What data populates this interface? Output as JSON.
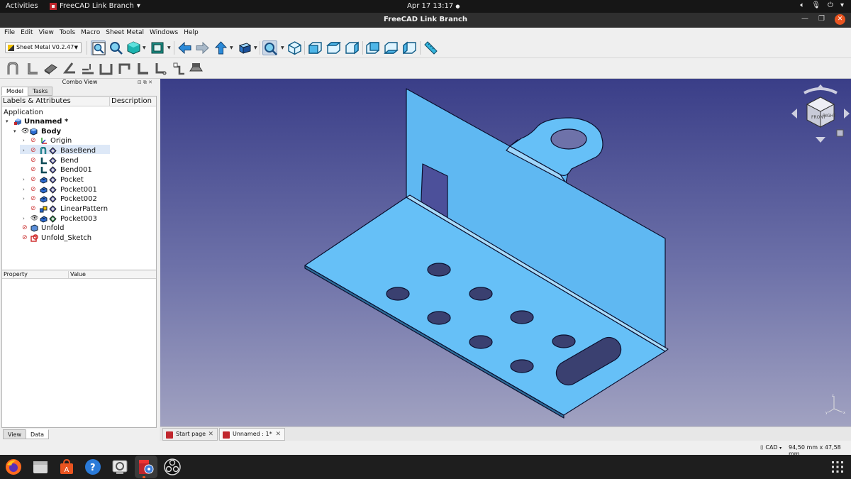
{
  "topbar": {
    "activities": "Activities",
    "app_menu": "FreeCAD Link Branch",
    "clock": "Apr 17  13:17",
    "clock_dot": "●"
  },
  "window": {
    "title": "FreeCAD Link Branch"
  },
  "menubar": [
    "File",
    "Edit",
    "View",
    "Tools",
    "Macro",
    "Sheet Metal",
    "Windows",
    "Help"
  ],
  "workbench_selector": {
    "value": "Sheet Metal V0.2.47"
  },
  "combo_view": {
    "title": "Combo View",
    "tabs": [
      "Model",
      "Tasks"
    ],
    "tree_columns": [
      "Labels & Attributes",
      "Description"
    ],
    "tree": [
      {
        "label": "Application"
      },
      {
        "label": "Unnamed *"
      },
      {
        "label": "Body"
      },
      {
        "label": "Origin"
      },
      {
        "label": "BaseBend"
      },
      {
        "label": "Bend"
      },
      {
        "label": "Bend001"
      },
      {
        "label": "Pocket"
      },
      {
        "label": "Pocket001"
      },
      {
        "label": "Pocket002"
      },
      {
        "label": "LinearPattern"
      },
      {
        "label": "Pocket003"
      },
      {
        "label": "Unfold"
      },
      {
        "label": "Unfold_Sketch"
      }
    ],
    "property_columns": [
      "Property",
      "Value"
    ],
    "bottom_tabs": [
      "View",
      "Data"
    ]
  },
  "document_tabs": [
    {
      "label": "Start page"
    },
    {
      "label": "Unnamed : 1*"
    }
  ],
  "statusbar": {
    "navigation_style": "CAD",
    "dimensions": "94,50 mm x 47,58 mm"
  },
  "colors": {
    "model_fill": "#66c0f7",
    "model_edge": "#0b1030",
    "background_top": "#3a3e88",
    "background_bottom": "#a1a2c1",
    "accent": "#e95420"
  }
}
